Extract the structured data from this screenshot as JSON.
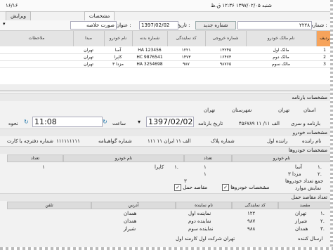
{
  "header": {
    "left_counter": "۱۶/۱۶",
    "datetime": "شنبه ۱۳۹۷/۰۲/۰۵ ۱۲:۳۶ ق.ظ",
    "tab_specs": "مشخصات",
    "tab_edit": "ویرایش"
  },
  "toolbar": {
    "number_label": "شماره :",
    "number_value": "۲۲۲۸",
    "new_number_label": "شماره جدید",
    "date_label": "تاریخ :",
    "date_value": "1397/02/02",
    "title_label": "عنوان :",
    "title_value": "صورت خلاصه"
  },
  "grid": {
    "columns": [
      "ردیف",
      "نام مالک خودرو",
      "شماره خروجی",
      "کد نمایندگی",
      "شماره بدنه",
      "نام خودرو",
      "مبدا",
      "ملاحظات"
    ],
    "rows": [
      {
        "row": "1",
        "owner": "مالک اول",
        "exit_no": "۱۳۲۴۵",
        "agency": "۱۲۲۱",
        "body": "HA 123456",
        "car": "آسا",
        "origin": "تهران",
        "notes": ""
      },
      {
        "row": "2",
        "owner": "مالک دوم",
        "exit_no": "۱۶۴۷۳",
        "agency": "۱۴۷۳",
        "body": "HC 9876541",
        "car": "کاپرا",
        "origin": "تهران",
        "notes": ""
      },
      {
        "row": "3",
        "owner": "مالک سوم",
        "exit_no": "۹۸۷۶۵",
        "agency": "۹۸۷",
        "body": "HA 3254698",
        "car": "مزدا ۳",
        "origin": "تهران",
        "notes": ""
      }
    ]
  },
  "waybill": {
    "section_title": "مشخصات بارنامه",
    "province_label": "استان",
    "province_value": "تهران",
    "city_label": "شهرستان",
    "city_value": "تهران",
    "series_label": "بارنامه و سری",
    "series_value": "۴۵۶۷۸۹ الف ۱۱/ ۱۱",
    "date_label": "تاریخ بارنامه",
    "date_value": "1397/02/02",
    "time_label": "ساعت",
    "time_value": "11:08",
    "mode_label": "نحوه"
  },
  "vehicle": {
    "section_title": "مشخصات خودرو",
    "driver_label": "نام راننده",
    "driver_value": "راننده اول",
    "plate_label": "شماره پلاک",
    "plate_value": "۱۱۱ الف ۱۱ ایران ۱۱",
    "cert_label": "شماره گواهینامه",
    "cert_value": "۱۱۱۱۱۱۱۱۱",
    "card_label": "شماره دفترچه یا کارت",
    "card_value": "۱۱۱۱۱۱۱۱۱۱"
  },
  "cars": {
    "section_title": "مشخصات خودروها",
    "left_headers": [
      "نام خودرو",
      "تعداد"
    ],
    "right_headers": [
      "نام خودرو",
      "تعداد"
    ],
    "left_rows": [
      {
        "no": "۱.",
        "name": "آسا",
        "count": "۱"
      },
      {
        "no": "۲.",
        "name": "مزدا ۳",
        "count": "۱"
      }
    ],
    "right_rows": [
      {
        "no": "۱.",
        "name": "کاپرا",
        "count": "۱"
      }
    ],
    "total_label": "جمع تعداد خودروها",
    "total_value": "۳",
    "show_label": "نمایش موارد",
    "opt_cars": "مشخصات خودروها",
    "opt_dest": "مقاصد حمل"
  },
  "destinations": {
    "section_title": "تعداد مقاصد حمل",
    "headers": [
      "مقصد",
      "کد نمایندگی",
      "نام نماینده",
      "آدرس",
      "تلفن"
    ],
    "rows": [
      {
        "no": "۱.",
        "dest": "تهران",
        "code": "۱۲۲",
        "agent": "نماینده اول",
        "addr": "همدان",
        "tel": ""
      },
      {
        "no": "۲.",
        "dest": "شیراز",
        "code": "۹۸۷",
        "agent": "نماینده دوم",
        "addr": "همدان",
        "tel": ""
      },
      {
        "no": "۳.",
        "dest": "همدان",
        "code": "۹۸۸",
        "agent": "نماینده سوم",
        "addr": "شیراز",
        "tel": ""
      }
    ]
  },
  "footer": {
    "sender_label": "ارسال کننده",
    "sender_value": "تهران شرکت اول کارمند اول"
  }
}
